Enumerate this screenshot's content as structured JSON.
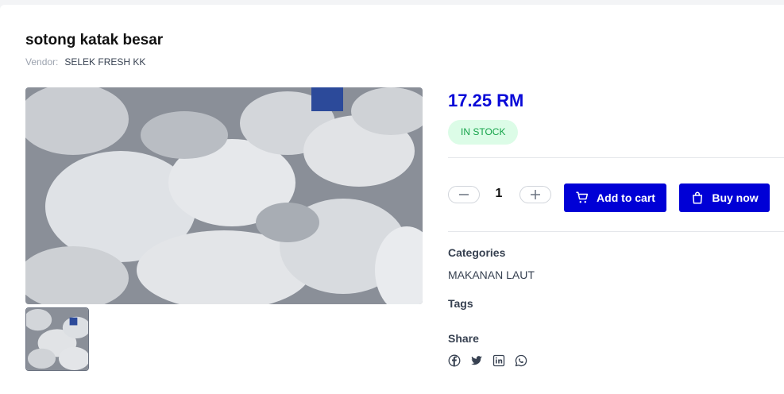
{
  "product": {
    "title": "sotong katak besar",
    "vendor_label": "Vendor:",
    "vendor_name": "SELEK FRESH KK",
    "price": "17.25 RM",
    "stock_status": "IN STOCK"
  },
  "cart": {
    "quantity": "1",
    "add_to_cart_label": "Add to cart",
    "buy_now_label": "Buy now",
    "button_color": "#0000d6"
  },
  "meta": {
    "categories_label": "Categories",
    "category_value": "MAKANAN LAUT",
    "tags_label": "Tags",
    "share_label": "Share"
  },
  "icons": {
    "share": [
      "facebook-icon",
      "twitter-icon",
      "linkedin-icon",
      "whatsapp-icon"
    ],
    "quantity": [
      "minus-icon",
      "plus-icon"
    ]
  },
  "colors": {
    "price": "#0a0ad8",
    "stock_bg": "#dcfce7",
    "stock_text": "#16a34a"
  }
}
